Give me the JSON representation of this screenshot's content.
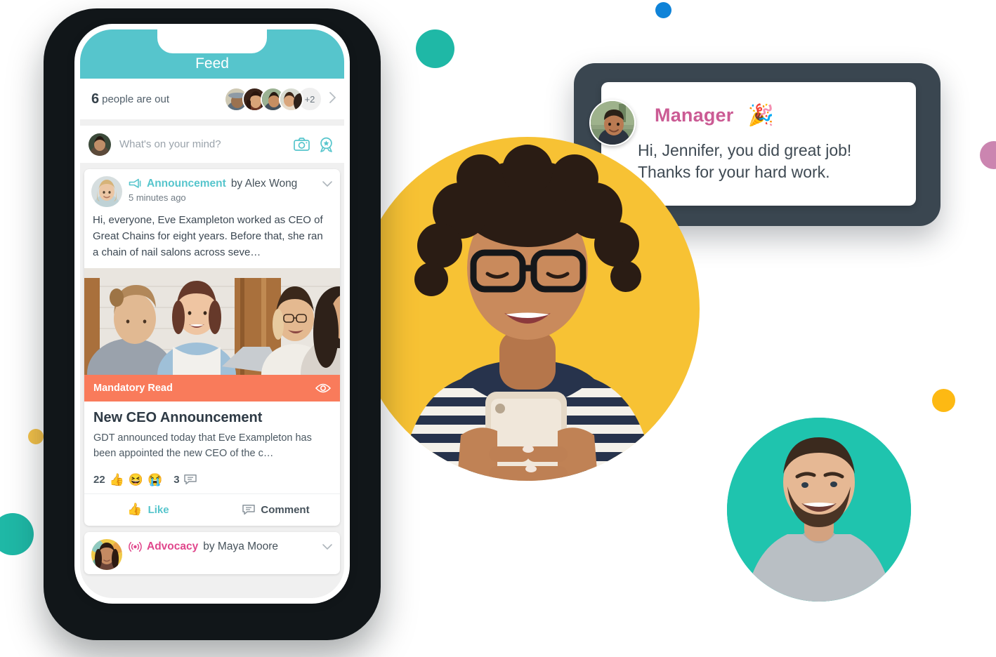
{
  "phone_app": {
    "header": {
      "title": "Feed"
    },
    "out_of_office": {
      "count": "6",
      "label": "people are out",
      "more_label": "+2",
      "chevron_icon": "chevron-right-icon"
    },
    "composer": {
      "placeholder": "What's on your mind?",
      "value": "",
      "camera_icon": "camera-icon",
      "award_icon": "award-badge-icon"
    },
    "posts": [
      {
        "kind_label": "Announcement",
        "kind_icon": "megaphone-icon",
        "by_text": "by Alex Wong",
        "timestamp": "5 minutes ago",
        "chevron_icon": "chevron-down-icon",
        "body": "Hi, everyone, Eve Exampleton worked as CEO of Great Chains for eight years. Before that, she ran a chain of nail salons across seve…",
        "photo_alt": "four-colleagues-at-table-photo",
        "banner": {
          "label": "Mandatory Read",
          "icon": "eye-icon"
        },
        "article": {
          "title": "New CEO Announcement",
          "description": "GDT announced today that Eve Exampleton has been appointed the new CEO of the c…"
        },
        "reactions": {
          "count": "22",
          "emojis": [
            "👍",
            "😆",
            "😭"
          ],
          "comment_count": "3",
          "comment_icon": "comment-bubble-icon"
        },
        "actions": {
          "like_label": "Like",
          "like_icon": "thumbs-up-icon",
          "comment_label": "Comment",
          "comment_icon": "comment-bubble-icon"
        }
      },
      {
        "kind_label": "Advocacy",
        "kind_icon": "broadcast-icon",
        "by_text": "by Maya Moore",
        "chevron_icon": "chevron-down-icon"
      }
    ]
  },
  "manager_card": {
    "name": "Manager",
    "emoji": "🎉",
    "message": "Hi, Jennifer, you did great job! Thanks for your hard work.",
    "avatar_alt": "manager-portrait"
  },
  "imagery": {
    "hero_alt": "woman-with-glasses-using-phone",
    "man_alt": "smiling-man-portrait"
  },
  "colors": {
    "teal_header": "#56C5CC",
    "coral_banner": "#F97B5B",
    "pink_accent": "#E0478C",
    "yellow_circle": "#F7C234",
    "teal_circle": "#1FC4AE",
    "dark_frame": "#3A4650",
    "blue_dot": "#0F83D8",
    "pink_dot": "#CB85B0",
    "orange_dot": "#FDB913"
  }
}
